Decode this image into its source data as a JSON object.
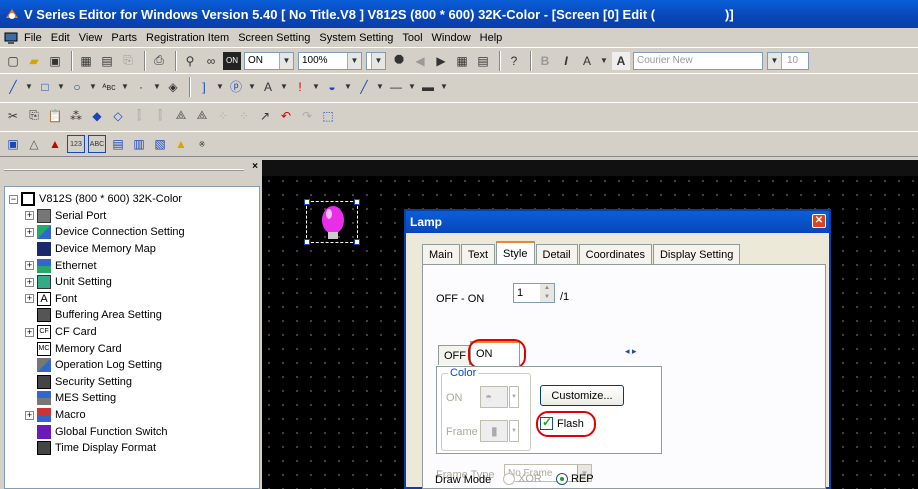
{
  "window": {
    "title": "V Series Editor for Windows Version 5.40 [ No Title.V8 ] V812S (800 * 600) 32K-Color - [Screen [0] Edit (",
    "title_tail": ")]"
  },
  "menu": [
    "File",
    "Edit",
    "View",
    "Parts",
    "Registration Item",
    "Screen Setting",
    "System Setting",
    "Tool",
    "Window",
    "Help"
  ],
  "toolbar1": {
    "onoff_combo": "ON",
    "zoom_combo": "100%",
    "font_combo": "Courier New",
    "size_combo": "10"
  },
  "tree": {
    "root": "V812S (800 * 600) 32K-Color",
    "items": [
      {
        "label": "Serial Port",
        "expander": "+"
      },
      {
        "label": "Device Connection Setting",
        "expander": "+"
      },
      {
        "label": "Device Memory Map",
        "expander": ""
      },
      {
        "label": "Ethernet",
        "expander": "+"
      },
      {
        "label": "Unit Setting",
        "expander": "+"
      },
      {
        "label": "Font",
        "expander": "+"
      },
      {
        "label": "Buffering Area Setting",
        "expander": ""
      },
      {
        "label": "CF Card",
        "expander": "+"
      },
      {
        "label": "Memory Card",
        "expander": ""
      },
      {
        "label": "Operation Log Setting",
        "expander": ""
      },
      {
        "label": "Security Setting",
        "expander": ""
      },
      {
        "label": "MES Setting",
        "expander": ""
      },
      {
        "label": "Macro",
        "expander": "+"
      },
      {
        "label": "Global Function Switch",
        "expander": ""
      },
      {
        "label": "Time Display Format",
        "expander": ""
      }
    ]
  },
  "dialog": {
    "title": "Lamp",
    "tabs": [
      "Main",
      "Text",
      "Style",
      "Detail",
      "Coordinates",
      "Display Setting"
    ],
    "active_tab": "Style",
    "off_on_label": "OFF - ON",
    "off_on_value": "1",
    "off_on_total": "/1",
    "subtabs": [
      "OFF",
      "ON"
    ],
    "color_group": "Color",
    "on_label": "ON",
    "frame_label": "Frame",
    "customize": "Customize...",
    "flash": "Flash",
    "frame_type_label": "Frame Type",
    "frame_type_value": "No Frame",
    "draw_mode_label": "Draw Mode",
    "draw_mode_xor": "XOR",
    "draw_mode_rep": "REP"
  }
}
